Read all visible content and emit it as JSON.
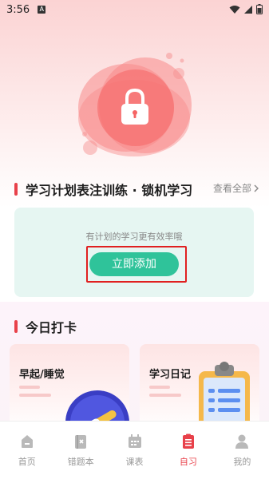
{
  "status_bar": {
    "time": "3:56",
    "notification_badge": "A"
  },
  "section1": {
    "title": "学习计划表注训练 · 锁机学习",
    "see_all": "查看全部"
  },
  "plan_card": {
    "hint": "有计划的学习更有效率哦",
    "add_button": "立即添加"
  },
  "section2": {
    "title": "今日打卡"
  },
  "checkin_cards": [
    {
      "title": "早起/睡觉",
      "icon": "moon-clock-icon"
    },
    {
      "title": "学习日记",
      "icon": "clipboard-icon"
    }
  ],
  "nav": {
    "items": [
      {
        "label": "首页",
        "icon": "home-icon",
        "active": false
      },
      {
        "label": "错题本",
        "icon": "wrong-book-icon",
        "active": false
      },
      {
        "label": "课表",
        "icon": "calendar-icon",
        "active": false
      },
      {
        "label": "自习",
        "icon": "study-list-icon",
        "active": true
      },
      {
        "label": "我的",
        "icon": "profile-icon",
        "active": false
      }
    ]
  },
  "colors": {
    "accent_red": "#e8414a",
    "button_green": "#2fc39a",
    "card_mint": "#e6f6f2",
    "highlight_red": "#e02020"
  }
}
